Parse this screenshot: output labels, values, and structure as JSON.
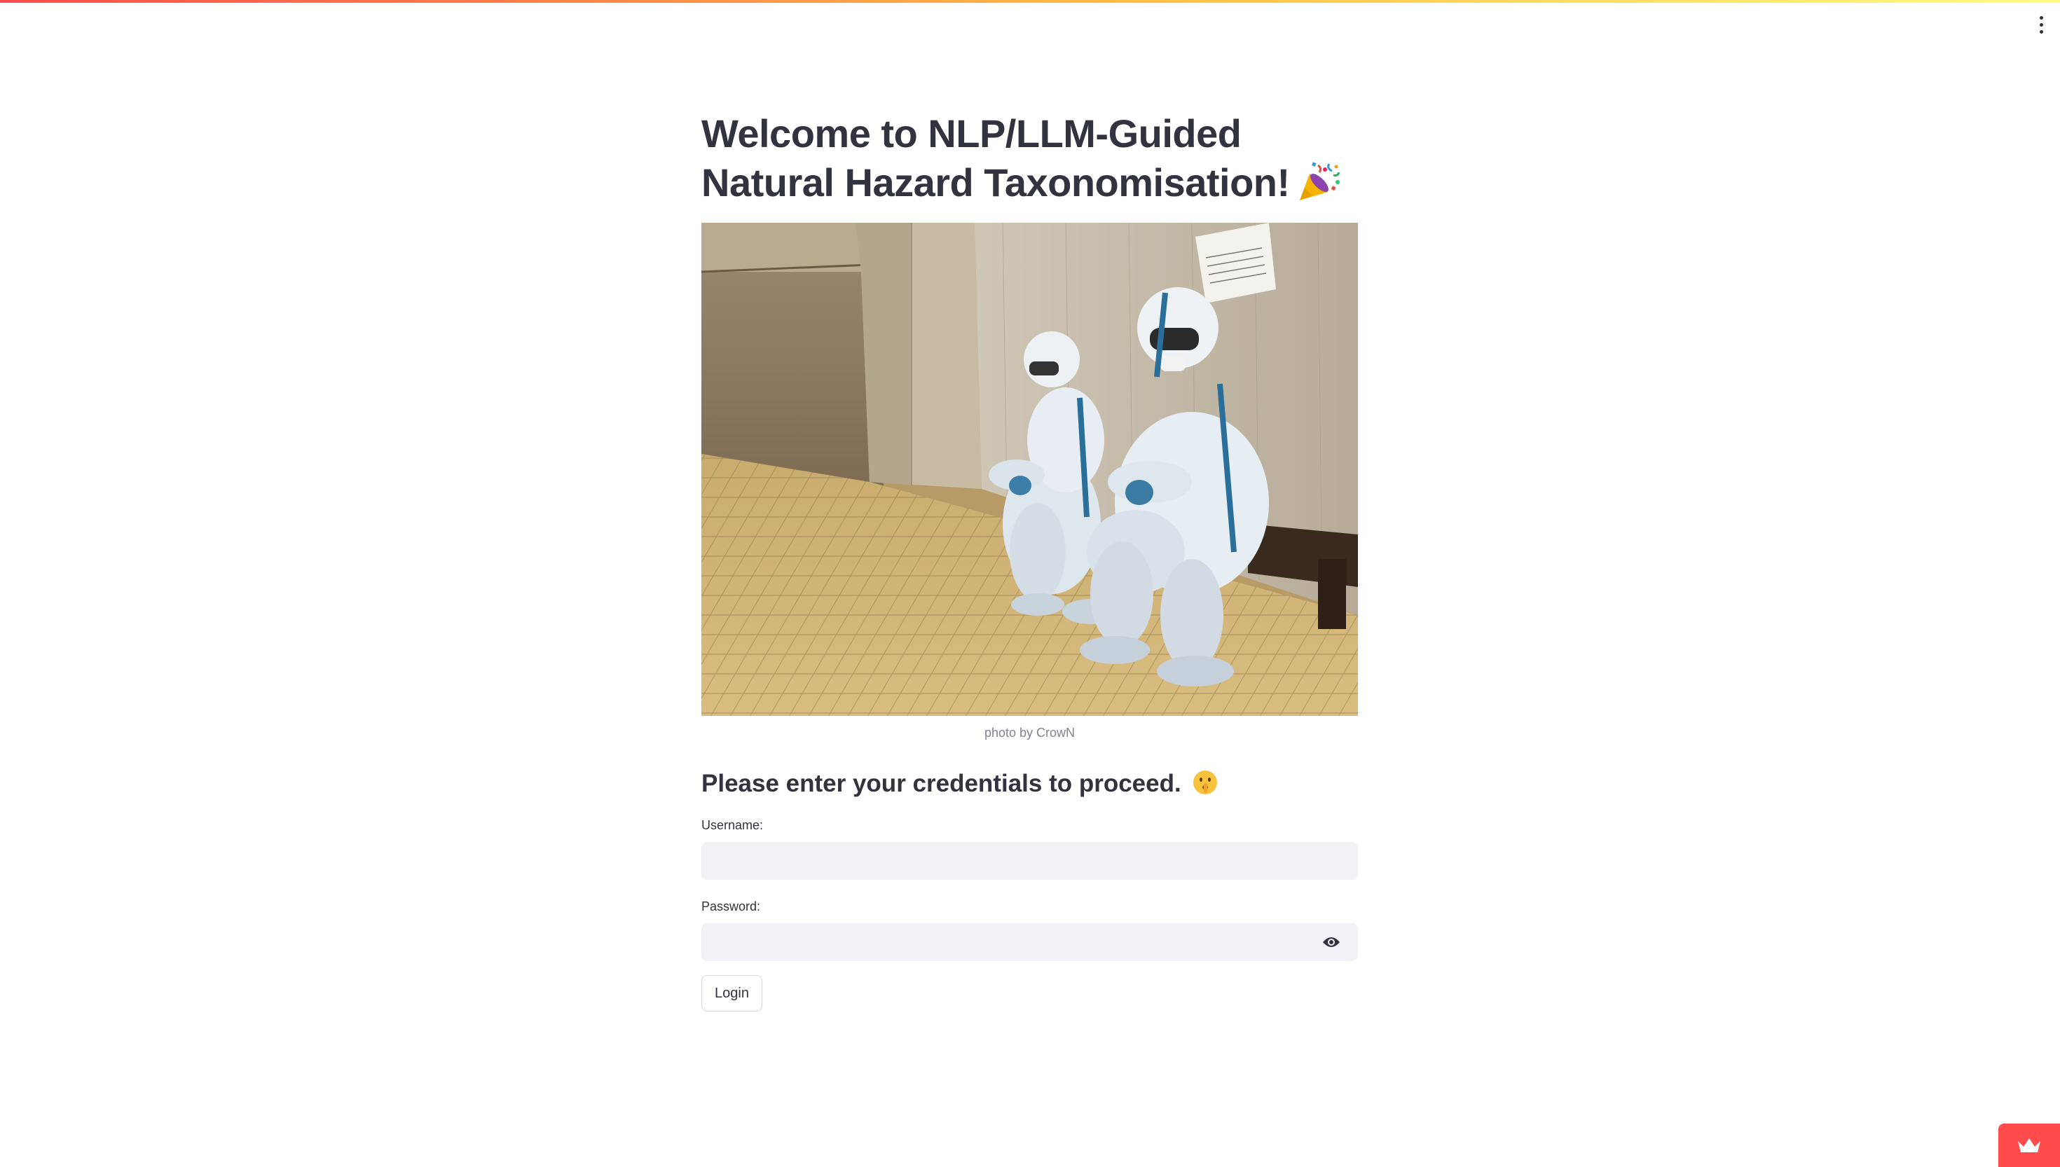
{
  "page": {
    "title_line1": "Welcome to NLP/LLM-Guided",
    "title_line2": "Natural Hazard Taxonomisation!",
    "title_emoji": "party-popper",
    "image_caption": "photo by CrowN",
    "subtitle": "Please enter your credentials to proceed.",
    "subtitle_emoji": "shushing-face"
  },
  "form": {
    "username_label": "Username:",
    "username_value": "",
    "password_label": "Password:",
    "password_value": "",
    "login_label": "Login"
  },
  "colors": {
    "accent": "#ff4b4b",
    "text": "#31333f",
    "input_bg": "#f0f2f6",
    "caption": "#808495"
  },
  "icons": {
    "menu": "vertical-ellipsis-icon",
    "password_toggle": "eye-icon",
    "badge": "crown-icon"
  }
}
